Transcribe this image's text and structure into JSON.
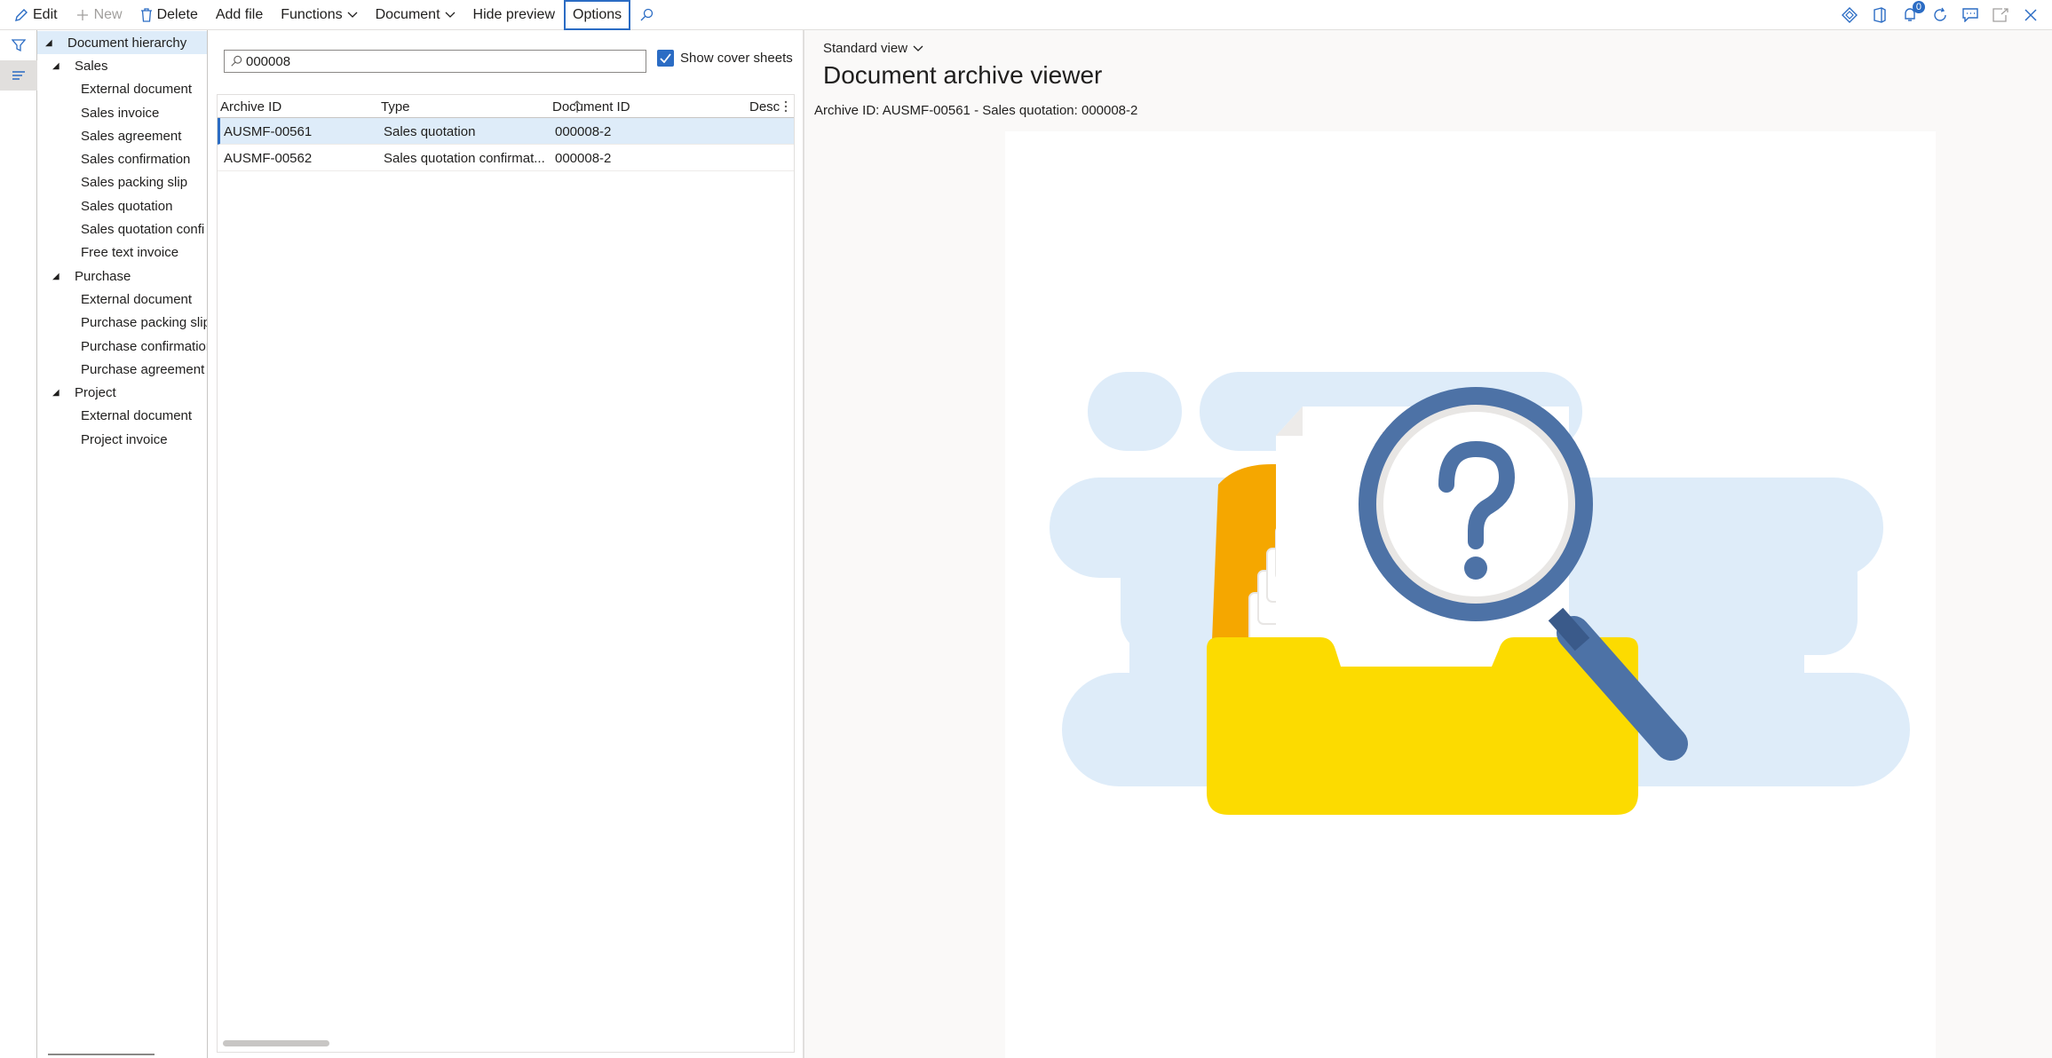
{
  "toolbar": {
    "edit": "Edit",
    "new": "New",
    "delete": "Delete",
    "add_file": "Add file",
    "functions": "Functions",
    "document": "Document",
    "hide_preview": "Hide preview",
    "options": "Options",
    "notification_count": "0"
  },
  "tree": {
    "root": "Document hierarchy",
    "groups": [
      {
        "label": "Sales",
        "items": [
          "External document",
          "Sales invoice",
          "Sales agreement",
          "Sales confirmation",
          "Sales packing slip",
          "Sales quotation",
          "Sales quotation confi",
          "Free text invoice"
        ]
      },
      {
        "label": "Purchase",
        "items": [
          "External document",
          "Purchase packing slip",
          "Purchase confirmation",
          "Purchase agreement"
        ]
      },
      {
        "label": "Project",
        "items": [
          "External document",
          "Project invoice"
        ]
      }
    ]
  },
  "search": {
    "value": "000008"
  },
  "cover_sheets": {
    "label": "Show cover sheets",
    "checked": true
  },
  "grid": {
    "columns": {
      "archive_id": "Archive ID",
      "type": "Type",
      "document_id": "Document ID",
      "desc": "Desc"
    },
    "rows": [
      {
        "archive_id": "AUSMF-00561",
        "type": "Sales quotation",
        "document_id": "000008-2"
      },
      {
        "archive_id": "AUSMF-00562",
        "type": "Sales quotation confirmat...",
        "document_id": "000008-2"
      }
    ]
  },
  "preview": {
    "view": "Standard view",
    "title": "Document archive viewer",
    "archive_label": "Archive ID: AUSMF-00561 - Sales quotation: 000008-2"
  },
  "colors": {
    "accent": "#2b6cc4",
    "selected_row": "#deecf9",
    "folder": "#fcdb00",
    "magnifier": "#4d72a6",
    "error_x": "#e03131"
  }
}
